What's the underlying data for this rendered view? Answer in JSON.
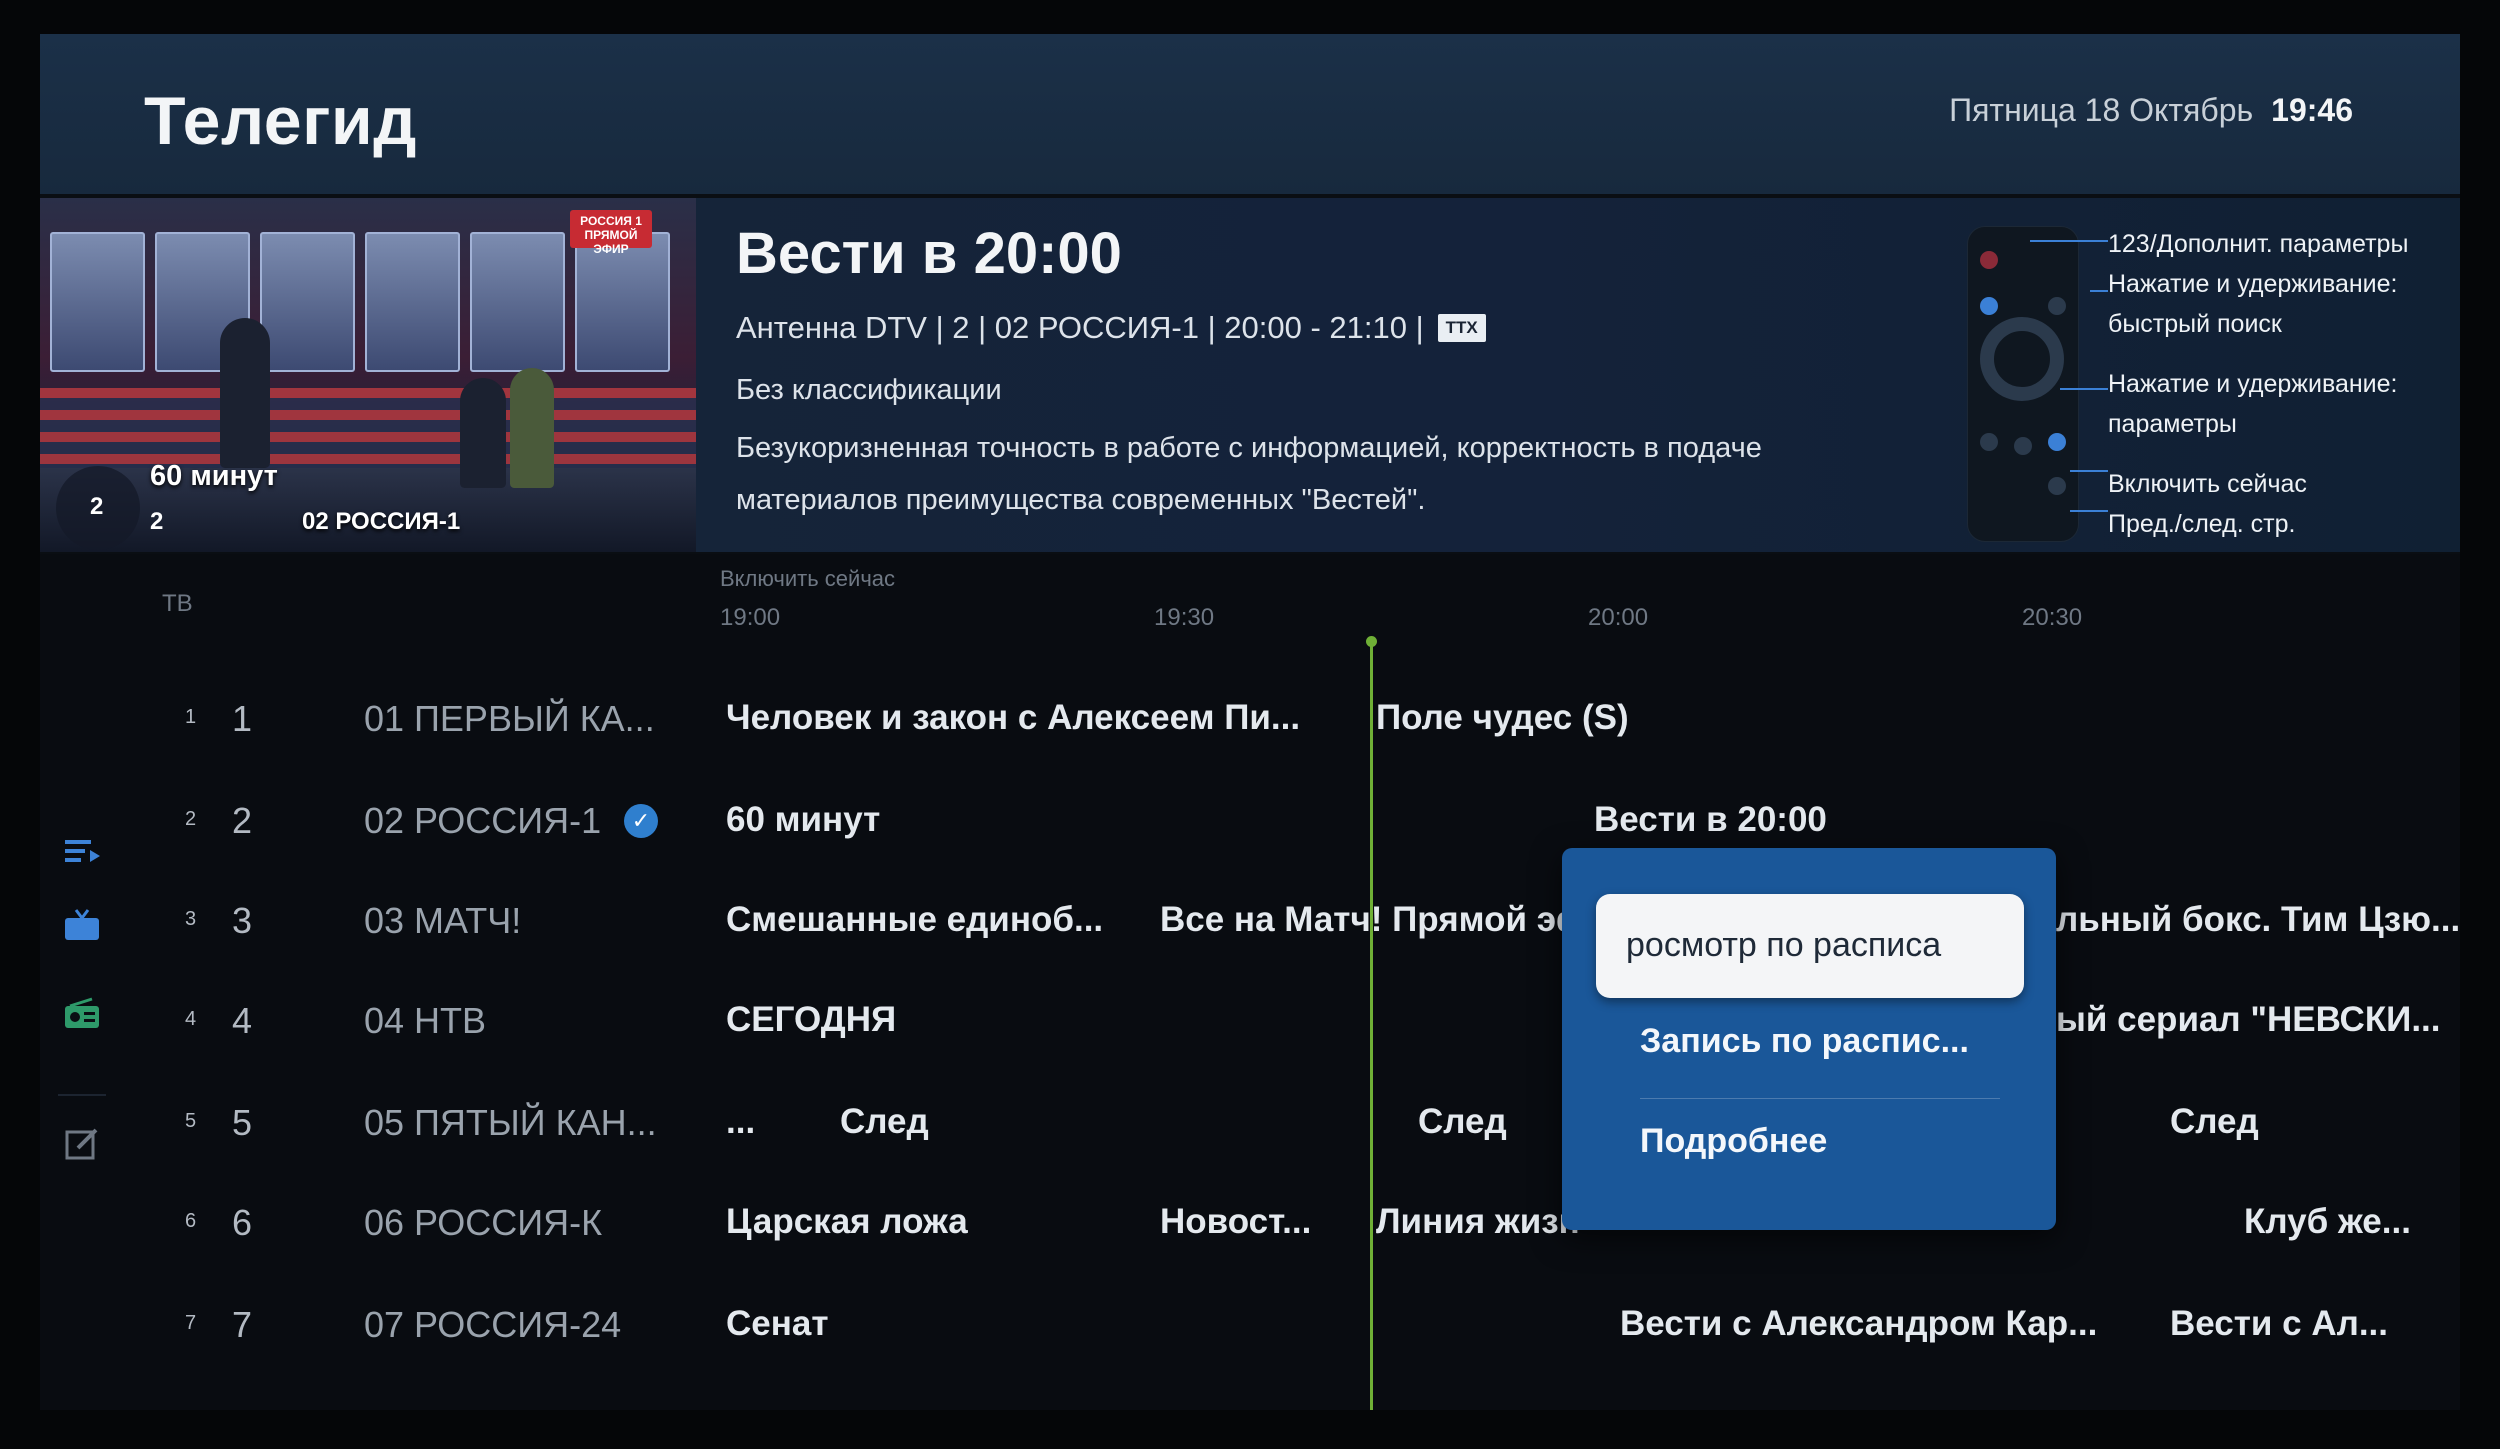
{
  "header": {
    "title": "Телегид",
    "date": "Пятница 18 Октябрь",
    "time": "19:46"
  },
  "preview": {
    "logo_text": "РОССИЯ 1 ПРЯМОЙ ЭФИР",
    "ring_number": "2",
    "program": "60 минут",
    "channel_number": "2",
    "channel_name": "02 РОССИЯ-1"
  },
  "program_info": {
    "title": "Вести в 20:00",
    "meta": "Антенна DTV | 2 | 02 РОССИЯ-1 | 20:00 - 21:10 |",
    "ttx_badge": "TTX",
    "classification": "Без классификации",
    "description": "Безукоризненная точность в работе с информацией, корректность в подаче материалов  преимущества современных \"Вестей\"."
  },
  "remote_hints": [
    "123/Дополнит. параметры",
    "Нажатие и удерживание:",
    "быстрый поиск",
    "Нажатие и удерживание:",
    "параметры",
    "Включить сейчас",
    "Пред./след. стр."
  ],
  "grid": {
    "tv_label": "ТВ",
    "now_label": "Включить сейчас",
    "times": [
      "19:00",
      "19:30",
      "20:00",
      "20:30"
    ],
    "rows": [
      {
        "idx": "1",
        "num": "1",
        "name": "01 ПЕРВЫЙ КА...",
        "programs": [
          "Человек и закон с Алексеем Пи...",
          "Поле чудес (S)"
        ]
      },
      {
        "idx": "2",
        "num": "2",
        "name": "02 РОССИЯ-1",
        "programs": [
          "60 минут",
          "Вести в 20:00"
        ]
      },
      {
        "idx": "3",
        "num": "3",
        "name": "03 МАТЧ!",
        "programs": [
          "Смешанные единоб...",
          "Все на Матч! Прямой эф",
          "льный бокс. Тим Цзю..."
        ]
      },
      {
        "idx": "4",
        "num": "4",
        "name": "04 НТВ",
        "programs": [
          "СЕГОДНЯ",
          "ый сериал \"НЕВСКИ..."
        ]
      },
      {
        "idx": "5",
        "num": "5",
        "name": "05 ПЯТЫЙ КАН...",
        "programs": [
          "...",
          "След",
          "След",
          "След"
        ]
      },
      {
        "idx": "6",
        "num": "6",
        "name": "06 РОССИЯ-К",
        "programs": [
          "Царская ложа",
          "Новост...",
          "Линия жизн",
          "Клуб же..."
        ]
      },
      {
        "idx": "7",
        "num": "7",
        "name": "07 РОССИЯ-24",
        "programs": [
          "Сенат",
          "Вести с Александром Кар...",
          "Вести с Ал..."
        ]
      }
    ]
  },
  "popup": {
    "selected": "росмотр по расписа",
    "item_record": "Запись по распис...",
    "item_details": "Подробнее"
  },
  "colors": {
    "accent": "#1a5799",
    "now_line": "#6fb036",
    "header_bg": "#1b3048",
    "icon_blue": "#3d83d8"
  }
}
